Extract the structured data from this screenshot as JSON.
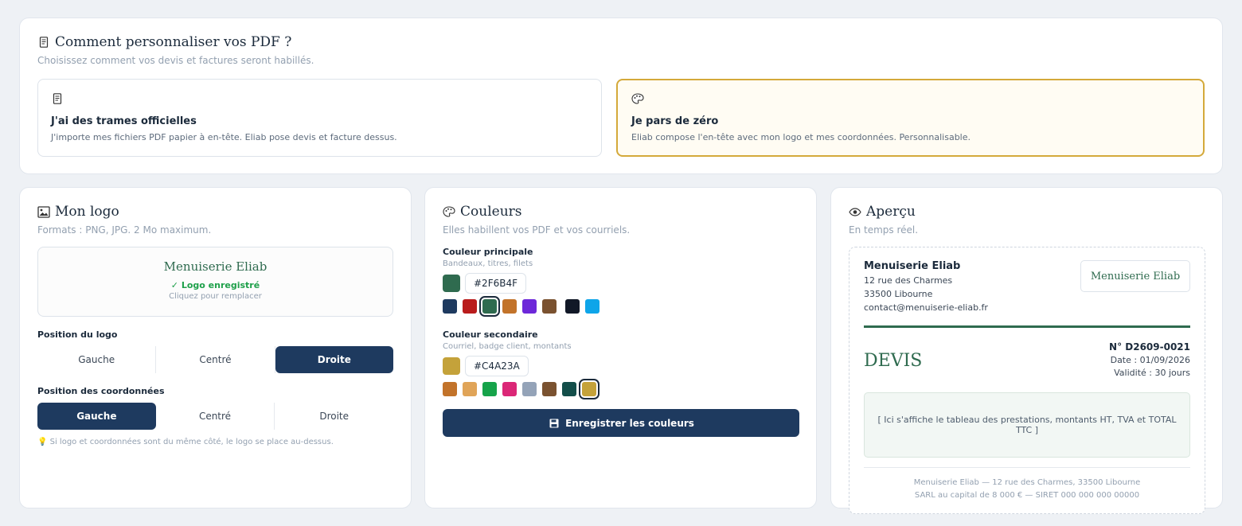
{
  "intro": {
    "title": "Comment personnaliser vos PDF ?",
    "subtitle": "Choisissez comment vos devis et factures seront habillés.",
    "choices": [
      {
        "icon": "document-icon",
        "title": "J'ai des trames officielles",
        "desc": "J'importe mes fichiers PDF papier à en-tête. Eliab pose devis et facture dessus.",
        "selected": false
      },
      {
        "icon": "palette-icon",
        "title": "Je pars de zéro",
        "desc": "Eliab compose l'en-tête avec mon logo et mes coordonnées. Personnalisable.",
        "selected": true
      }
    ]
  },
  "logo": {
    "title": "Mon logo",
    "subtitle": "Formats : PNG, JPG. 2 Mo maximum.",
    "brand": "Menuiserie Eliab",
    "status": "✓ Logo enregistré",
    "replace": "Cliquez pour remplacer",
    "logo_position_label": "Position du logo",
    "logo_position_options": [
      "Gauche",
      "Centré",
      "Droite"
    ],
    "logo_position_selected": "Droite",
    "coords_position_label": "Position des coordonnées",
    "coords_position_options": [
      "Gauche",
      "Centré",
      "Droite"
    ],
    "coords_position_selected": "Gauche",
    "tip": "💡 Si logo et coordonnées sont du même côté, le logo se place au-dessus."
  },
  "colors": {
    "title": "Couleurs",
    "subtitle": "Elles habillent vos PDF et vos courriels.",
    "primary": {
      "label": "Couleur principale",
      "hint": "Bandeaux, titres, filets",
      "value": "#2F6B4F",
      "swatches": [
        "#1e3a5f",
        "#b91c1c",
        "#2f6b4f",
        "#c2732a",
        "#6d28d9",
        "#7a5230",
        "#111827",
        "#0ea5e9"
      ],
      "selected_index": 2
    },
    "secondary": {
      "label": "Couleur secondaire",
      "hint": "Courriel, badge client, montants",
      "value": "#C4A23A",
      "swatches": [
        "#c2732a",
        "#e0a458",
        "#16a34a",
        "#db2777",
        "#94a3b8",
        "#7a5230",
        "#134e4a",
        "#c4a23a"
      ],
      "selected_index": 7
    },
    "save_label": "Enregistrer les couleurs"
  },
  "preview": {
    "title": "Aperçu",
    "subtitle": "En temps réel.",
    "company": "Menuiserie Eliab",
    "address1": "12 rue des Charmes",
    "address2": "33500 Libourne",
    "email": "contact@menuiserie-eliab.fr",
    "logo_text": "Menuiserie Eliab",
    "doc_type": "DEVIS",
    "number": "N° D2609-0021",
    "date": "Date : 01/09/2026",
    "validity": "Validité : 30 jours",
    "table_placeholder": "[ Ici s'affiche le tableau des prestations, montants HT, TVA et TOTAL TTC ]",
    "footer1": "Menuiserie Eliab — 12 rue des Charmes, 33500 Libourne",
    "footer2": "SARL au capital de 8 000 € — SIRET 000 000 000 00000"
  }
}
